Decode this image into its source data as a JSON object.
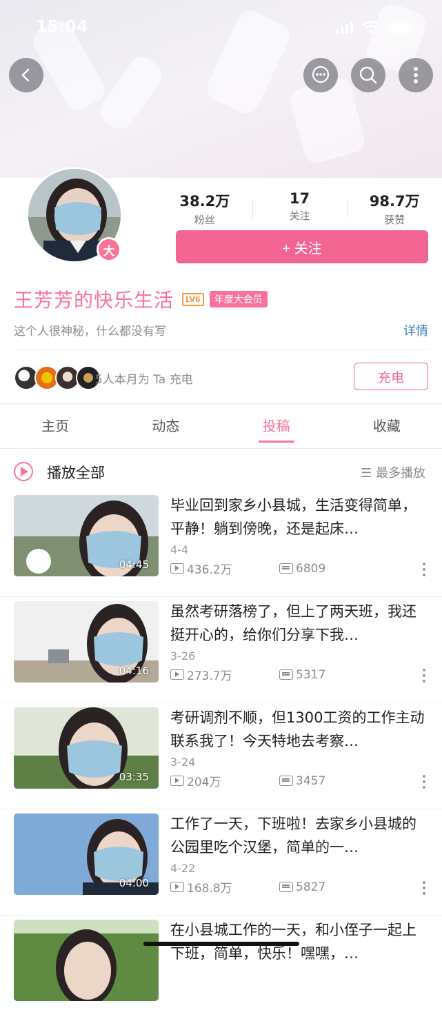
{
  "status_bar": {
    "time": "15:04"
  },
  "nav": {
    "back_icon": "back-arrow-icon",
    "message_icon": "chat-bubble-icon",
    "search_icon": "search-icon",
    "more_icon": "more-vertical-icon"
  },
  "profile": {
    "badge": "大",
    "stats": [
      {
        "value": "38.2万",
        "label": "粉丝"
      },
      {
        "value": "17",
        "label": "关注"
      },
      {
        "value": "98.7万",
        "label": "获赞"
      }
    ],
    "follow_label": "+ 关注",
    "name": "王芳芳的快乐生活",
    "level": "LV6",
    "vip": "年度大会员",
    "bio": "这个人很神秘，什么都没有写",
    "detail_link": "详情",
    "charge_text": "5人本月为 Ta 充电",
    "charge_button": "充电"
  },
  "tabs": [
    {
      "label": "主页",
      "active": false
    },
    {
      "label": "动态",
      "active": false
    },
    {
      "label": "投稿",
      "active": true
    },
    {
      "label": "收藏",
      "active": false
    }
  ],
  "list_header": {
    "play_all": "播放全部",
    "sort": "☰ 最多播放"
  },
  "videos": [
    {
      "title": "毕业回到家乡小县城，生活变得简单，平静！躺到傍晚，还是起床…",
      "date": "4-4",
      "duration": "04:45",
      "views": "436.2万",
      "danmaku": "6809"
    },
    {
      "title": "虽然考研落榜了，但上了两天班，我还挺开心的，给你们分享下我…",
      "date": "3-26",
      "duration": "04:16",
      "views": "273.7万",
      "danmaku": "5317"
    },
    {
      "title": "考研调剂不顺，但1300工资的工作主动联系我了！今天特地去考察…",
      "date": "3-24",
      "duration": "03:35",
      "views": "204万",
      "danmaku": "3457"
    },
    {
      "title": "工作了一天，下班啦！去家乡小县城的公园里吃个汉堡，简单的一…",
      "date": "4-22",
      "duration": "04:00",
      "views": "168.8万",
      "danmaku": "5827"
    },
    {
      "title": "在小县城工作的一天，和小侄子一起上下班，简单，快乐！嘿嘿，…",
      "date": "",
      "duration": "",
      "views": "",
      "danmaku": ""
    }
  ],
  "colors": {
    "brand_pink": "#fb7299",
    "button_pink": "#f26592",
    "link_blue": "#3a7fb8",
    "level_orange": "#f29a3b"
  }
}
